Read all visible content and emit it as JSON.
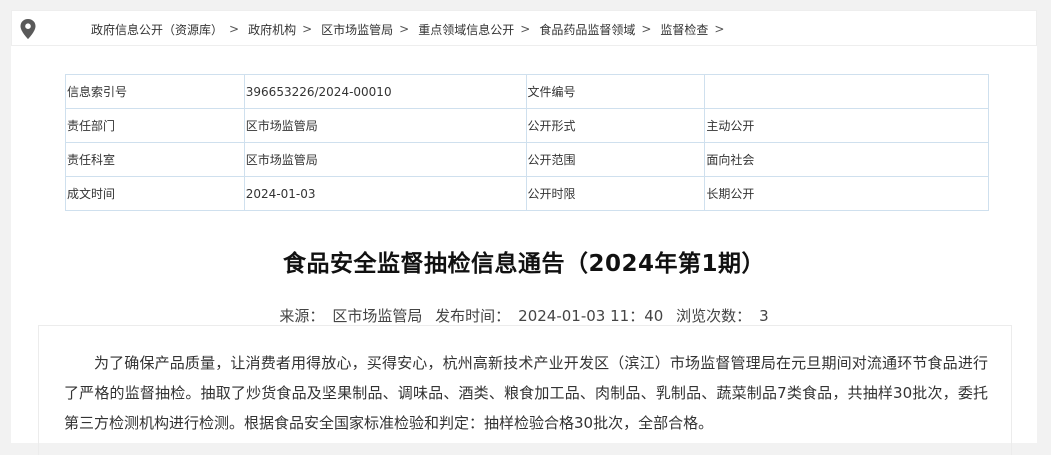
{
  "breadcrumb": {
    "items": [
      "政府信息公开（资源库）",
      "政府机构",
      "区市场监管局",
      "重点领域信息公开",
      "食品药品监督领域",
      "监督检查"
    ],
    "separator": ">"
  },
  "meta": {
    "rows": [
      [
        "信息索引号",
        "396653226/2024-00010",
        "文件编号",
        ""
      ],
      [
        "责任部门",
        "区市场监管局",
        "公开形式",
        "主动公开"
      ],
      [
        "责任科室",
        "区市场监管局",
        "公开范围",
        "面向社会"
      ],
      [
        "成文时间",
        "2024-01-03",
        "公开时限",
        "长期公开"
      ]
    ]
  },
  "article": {
    "title": "食品安全监督抽检信息通告（2024年第1期）",
    "source_label": "来源：",
    "source": "区市场监管局",
    "published_label": "发布时间：",
    "published": "2024-01-03 11：40",
    "views_label": "浏览次数：",
    "views": "3",
    "body": "为了确保产品质量，让消费者用得放心，买得安心，杭州高新技术产业开发区（滨江）市场监督管理局在元旦期间对流通环节食品进行了严格的监督抽检。抽取了炒货食品及坚果制品、调味品、酒类、粮食加工品、肉制品、乳制品、蔬菜制品7类食品，共抽样30批次，委托第三方检测机构进行检测。根据食品安全国家标准检验和判定：抽样检验合格30批次，全部合格。"
  },
  "icons": {
    "location": "map-pin-icon"
  },
  "colors": {
    "page_bg": "#f2f2f2",
    "table_border": "#cfe0ee",
    "text": "#333333"
  }
}
